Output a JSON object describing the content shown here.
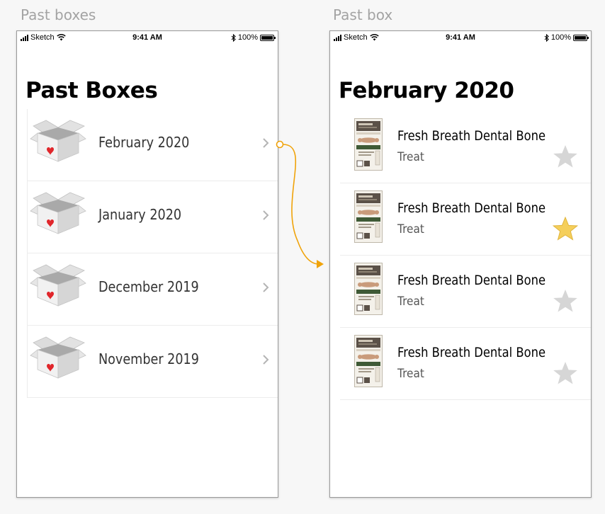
{
  "artboards": {
    "left_label": "Past boxes",
    "right_label": "Past box"
  },
  "status_bar": {
    "carrier": "Sketch",
    "time": "9:41 AM",
    "battery": "100%"
  },
  "past_boxes": {
    "title": "Past Boxes",
    "items": [
      {
        "label": "February 2020"
      },
      {
        "label": "January 2020"
      },
      {
        "label": "December 2019"
      },
      {
        "label": "November 2019"
      }
    ]
  },
  "past_box": {
    "title": "February 2020",
    "items": [
      {
        "name": "Fresh Breath Dental Bone",
        "type": "Treat",
        "favorited": false
      },
      {
        "name": "Fresh Breath Dental Bone",
        "type": "Treat",
        "favorited": true
      },
      {
        "name": "Fresh Breath Dental Bone",
        "type": "Treat",
        "favorited": false
      },
      {
        "name": "Fresh Breath Dental Bone",
        "type": "Treat",
        "favorited": false
      }
    ]
  },
  "colors": {
    "star_active": "#f5cf5b",
    "star_inactive": "#d6d6d6",
    "flow_arrow": "#f0a30a",
    "heart": "#e0262b"
  }
}
